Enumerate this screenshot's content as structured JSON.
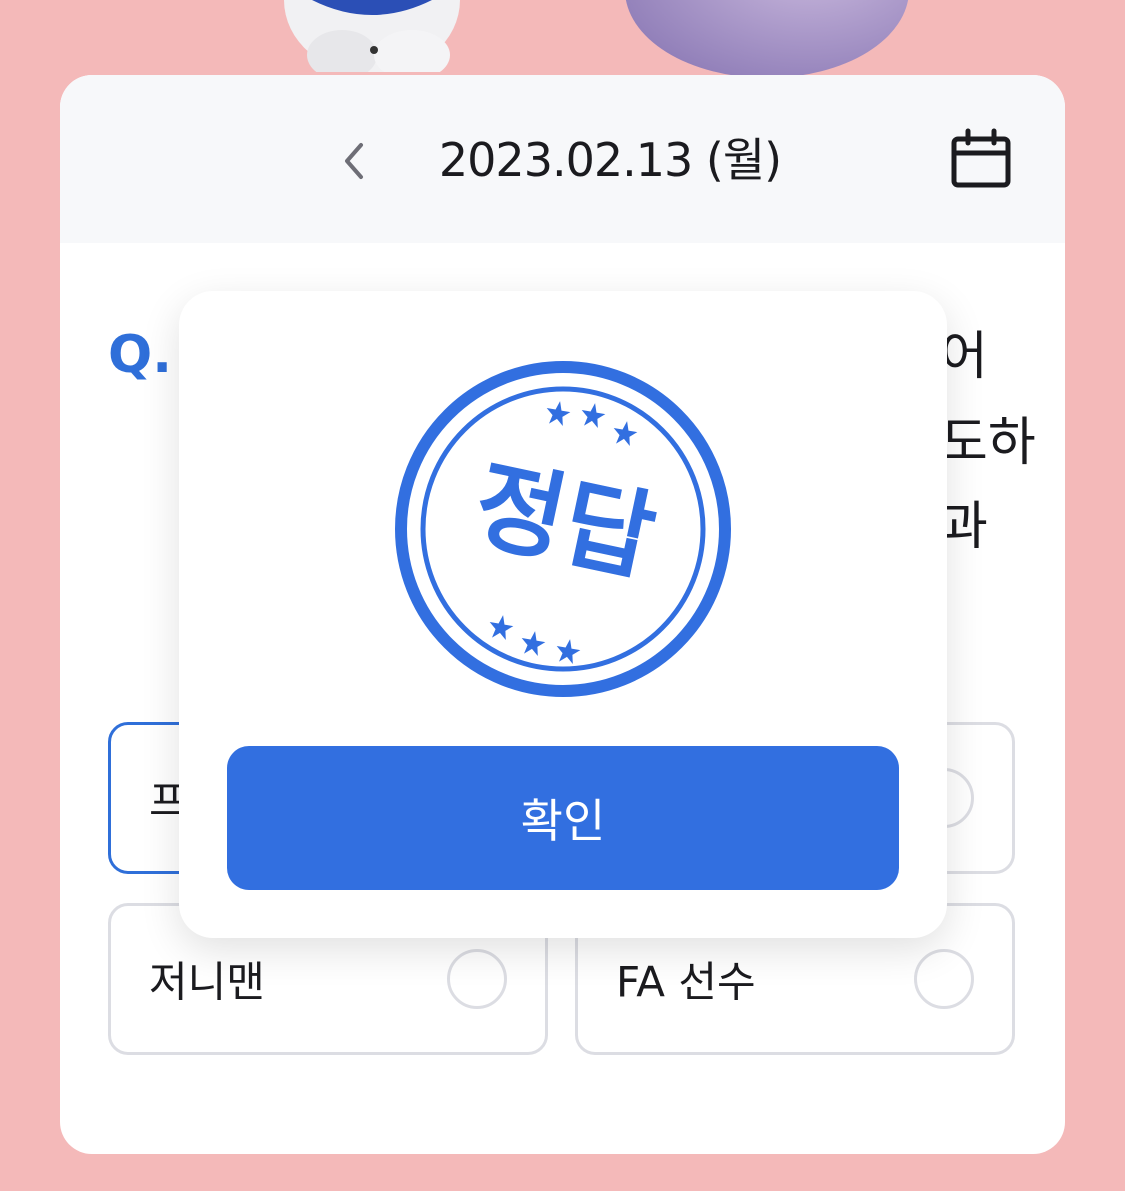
{
  "header": {
    "date_title": "2023.02.13 (월)",
    "prev_icon": "chevron-left-icon",
    "calendar_icon": "calendar-icon"
  },
  "question": {
    "prefix": "Q.",
    "visible_line_endings": [
      "어",
      "도하",
      "과"
    ]
  },
  "options": [
    {
      "label": "프",
      "selected": true
    },
    {
      "label": "",
      "selected": false
    },
    {
      "label": "저니맨",
      "selected": false
    },
    {
      "label": "FA 선수",
      "selected": false
    }
  ],
  "modal": {
    "stamp_text": "정답",
    "confirm_label": "확인"
  },
  "colors": {
    "background": "#f4b9b9",
    "accent": "#326fe0",
    "card": "#ffffff",
    "header": "#f7f8fa"
  }
}
